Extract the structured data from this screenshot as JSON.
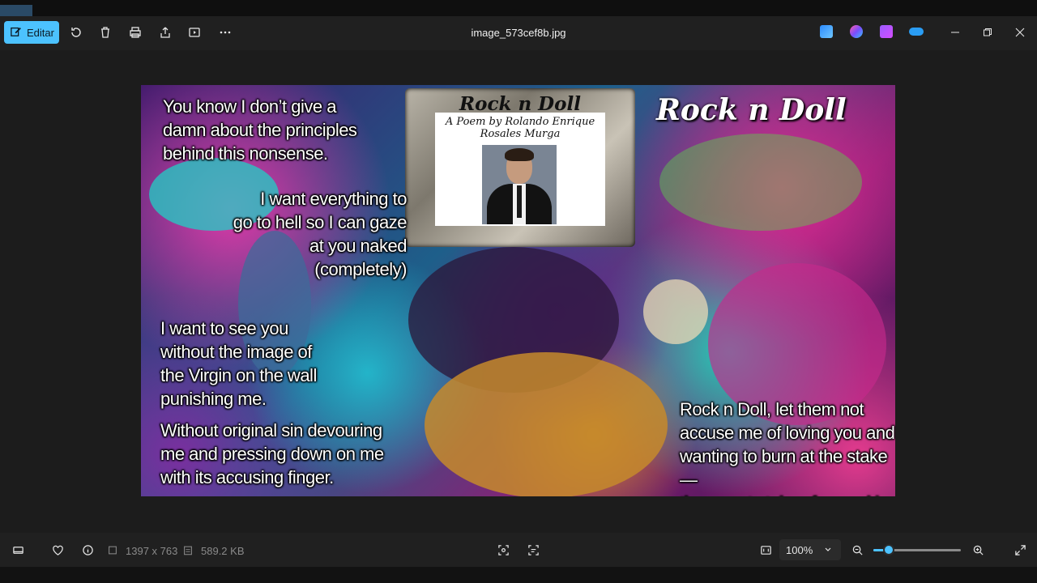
{
  "toolbar": {
    "edit_label": "Editar",
    "title": "image_573cef8b.jpg"
  },
  "artwork": {
    "frame_title": "Rock n Doll",
    "frame_subtitle": "A Poem by Rolando Enrique\nRosales Murga",
    "title": "Rock n Doll",
    "verse1": "You know I don’t give a\ndamn about the principles\nbehind this nonsense.",
    "verse2": "I want everything to\ngo to hell so I can gaze\nat you naked\n(completely)",
    "verse3": "I want to see you\n without the image of\nthe Virgin on the wall\npunishing me.",
    "verse4": "Without original sin devouring\nme and pressing down on me\nwith its accusing finger.",
    "verse5": "Rock n Doll, let them not\naccuse me of loving you and\nwanting to burn at the stake—\nthe sweet stake of your skin."
  },
  "status": {
    "dimensions": "1397 x 763",
    "filesize": "589.2 KB",
    "zoom": "100%",
    "zoom_level": 0.18
  }
}
